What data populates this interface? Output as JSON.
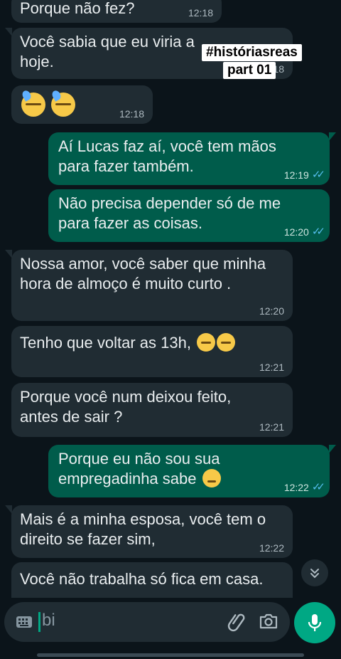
{
  "messages": [
    {
      "text": "Porque não fez?",
      "time": "12:18"
    },
    {
      "text_line1": "Você sabia que eu viria a",
      "text_line2": "hoje.",
      "time": "12:18"
    },
    {
      "time": "12:18"
    },
    {
      "text_line1": "Aí Lucas faz aí, você tem mãos",
      "text_line2": "para fazer também.",
      "time": "12:19"
    },
    {
      "text_line1": "Não precisa depender só de me",
      "text_line2": "para fazer as coisas.",
      "time": "12:20"
    },
    {
      "text_line1": "Nossa amor, você saber que minha",
      "text_line2": "hora de almoço é muito curto .",
      "time": "12:20"
    },
    {
      "text": "Tenho que voltar as 13h,",
      "time": "12:21"
    },
    {
      "text_line1": "Porque você num deixou feito,",
      "text_line2": "antes de sair ?",
      "time": "12:21"
    },
    {
      "text_line1": "Porque eu não sou sua",
      "text_line2": "empregadinha sabe",
      "time": "12:22"
    },
    {
      "text_line1": "Mais é a minha esposa, você tem o",
      "text_line2": "direito se fazer sim,",
      "time": "12:22"
    },
    {
      "text": "Você não trabalha só fica em casa."
    }
  ],
  "sticker": {
    "line1": "#históriasreas",
    "line2": "part 01"
  },
  "input": {
    "value": "bi"
  },
  "icons": {
    "keyboard": "keyboard-icon",
    "attach": "paperclip-icon",
    "camera": "camera-icon",
    "mic": "microphone-icon",
    "scroll": "double-chevron-down-icon",
    "read_ticks": "double-check-icon"
  },
  "colors": {
    "background": "#0b141a",
    "incoming": "#202c33",
    "outgoing": "#005c4b",
    "accent": "#00a884",
    "read_tick": "#53bdeb"
  }
}
